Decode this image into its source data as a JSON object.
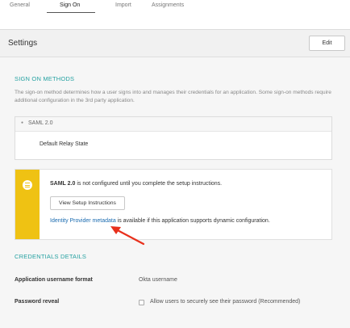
{
  "tabs": [
    {
      "label": "General"
    },
    {
      "label": "Sign On"
    },
    {
      "label": "Import"
    },
    {
      "label": "Assignments"
    }
  ],
  "settings": {
    "title": "Settings",
    "edit_label": "Edit"
  },
  "sign_on": {
    "title": "SIGN ON METHODS",
    "description": "The sign-on method determines how a user signs into and manages their credentials for an application. Some sign-on methods require additional configuration in the 3rd party application.",
    "saml_label": "SAML 2.0",
    "relay_label": "Default Relay State"
  },
  "notice": {
    "bold": "SAML 2.0",
    "text": " is not configured until you complete the setup instructions.",
    "button_label": "View Setup Instructions",
    "link_label": "Identity Provider metadata",
    "link_suffix": " is available if this application supports dynamic configuration.",
    "accent_color": "#efc213",
    "icon": "list-icon"
  },
  "credentials": {
    "title": "CREDENTIALS DETAILS",
    "username_format_label": "Application username format",
    "username_format_value": "Okta username",
    "password_reveal_label": "Password reveal",
    "password_reveal_option": "Allow users to securely see their password (Recommended)",
    "password_reveal_checked": false
  },
  "colors": {
    "section_title": "#27a2a2",
    "link": "#1a6bb0",
    "arrow": "#e8301c"
  }
}
